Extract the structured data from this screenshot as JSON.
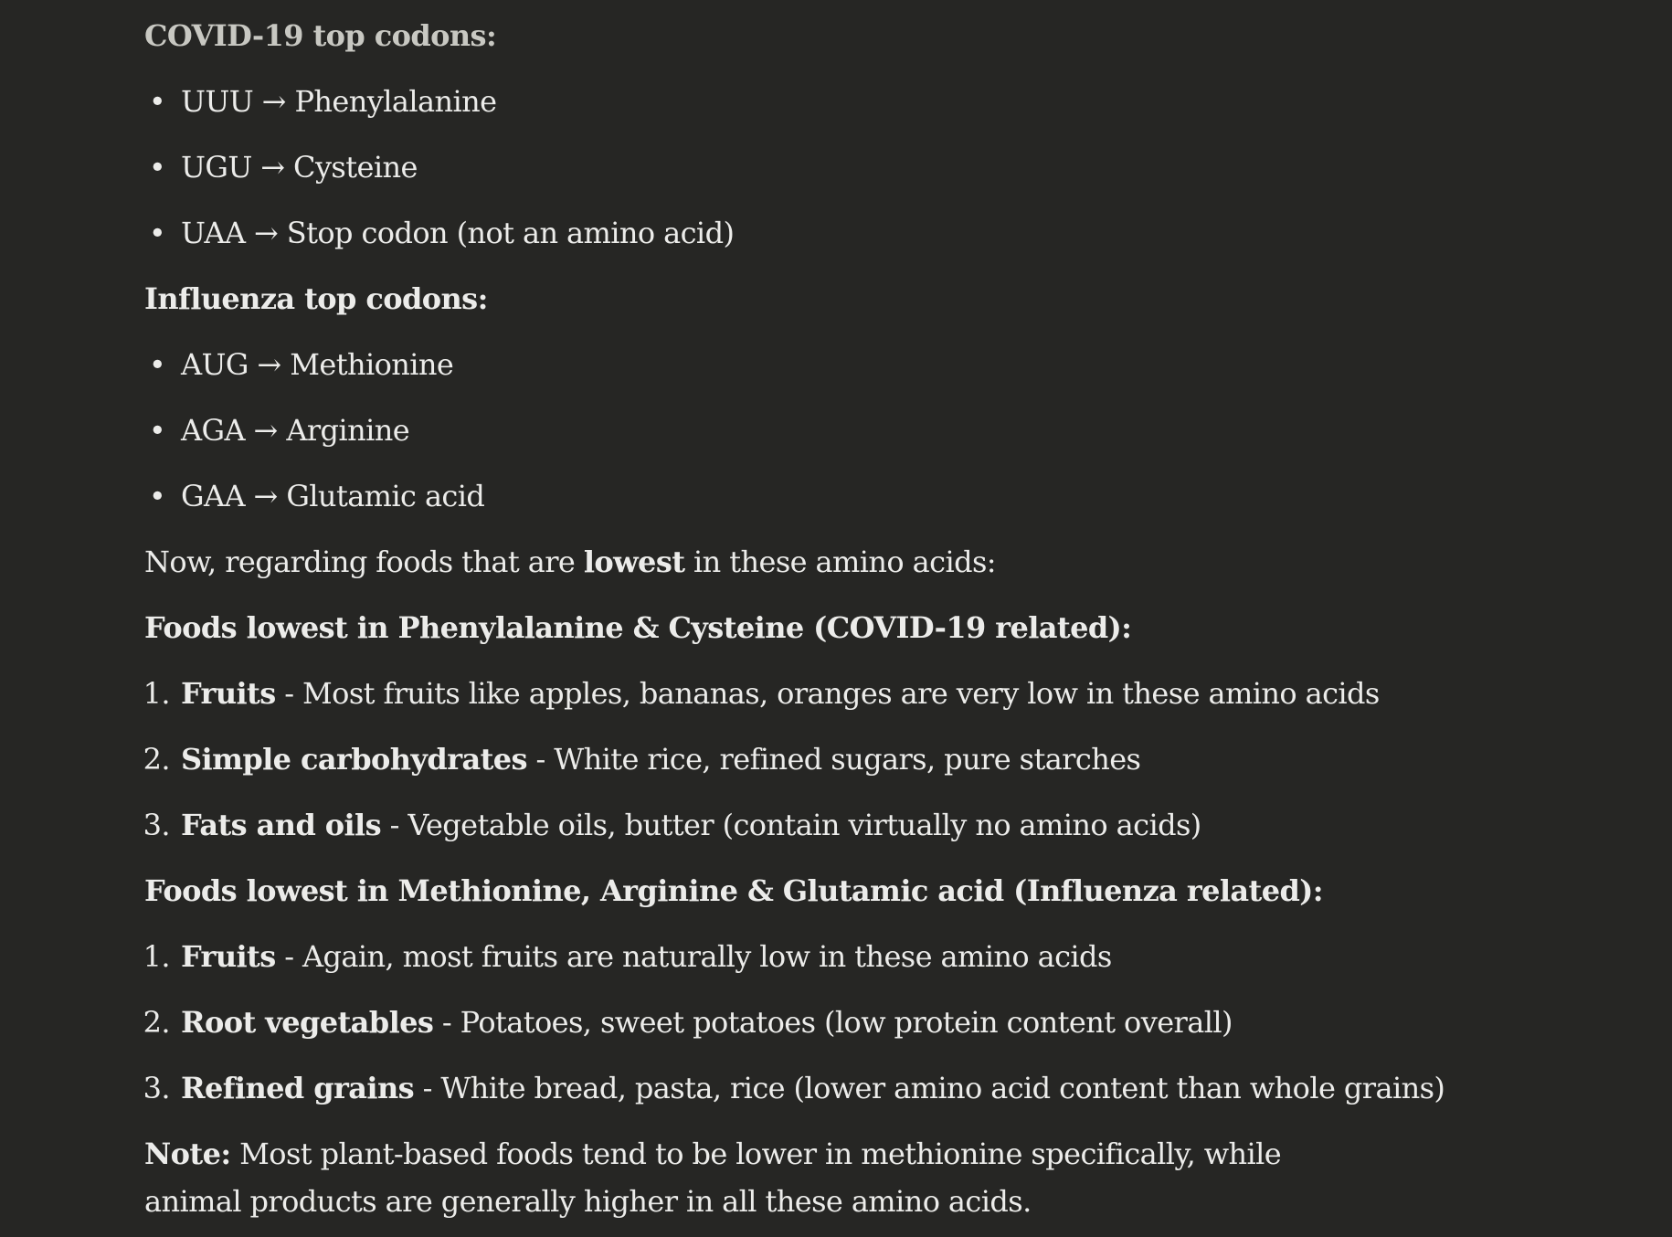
{
  "covid": {
    "heading": "COVID-19 top codons:",
    "items": [
      "UUU → Phenylalanine",
      "UGU → Cysteine",
      "UAA → Stop codon (not an amino acid)"
    ]
  },
  "influenza": {
    "heading": "Influenza top codons:",
    "items": [
      "AUG → Methionine",
      "AGA → Arginine",
      "GAA → Glutamic acid"
    ]
  },
  "intro": {
    "before": "Now, regarding foods that are ",
    "emphasis": "lowest",
    "after": " in these amino acids:"
  },
  "covid_foods": {
    "heading": "Foods lowest in Phenylalanine & Cysteine (COVID-19 related):",
    "items": [
      {
        "num": "1.",
        "term": "Fruits",
        "desc": " - Most fruits like apples, bananas, oranges are very low in these amino acids"
      },
      {
        "num": "2.",
        "term": "Simple carbohydrates",
        "desc": " - White rice, refined sugars, pure starches"
      },
      {
        "num": "3.",
        "term": "Fats and oils",
        "desc": " - Vegetable oils, butter (contain virtually no amino acids)"
      }
    ]
  },
  "flu_foods": {
    "heading": "Foods lowest in Methionine, Arginine & Glutamic acid (Influenza related):",
    "items": [
      {
        "num": "1.",
        "term": "Fruits",
        "desc": " - Again, most fruits are naturally low in these amino acids"
      },
      {
        "num": "2.",
        "term": "Root vegetables",
        "desc": " - Potatoes, sweet potatoes (low protein content overall)"
      },
      {
        "num": "3.",
        "term": "Refined grains",
        "desc": " - White bread, pasta, rice (lower amino acid content than whole grains)"
      }
    ]
  },
  "note": {
    "label": "Note:",
    "text": " Most plant-based foods tend to be lower in methionine specifically, while animal products are generally higher in all these amino acids."
  }
}
